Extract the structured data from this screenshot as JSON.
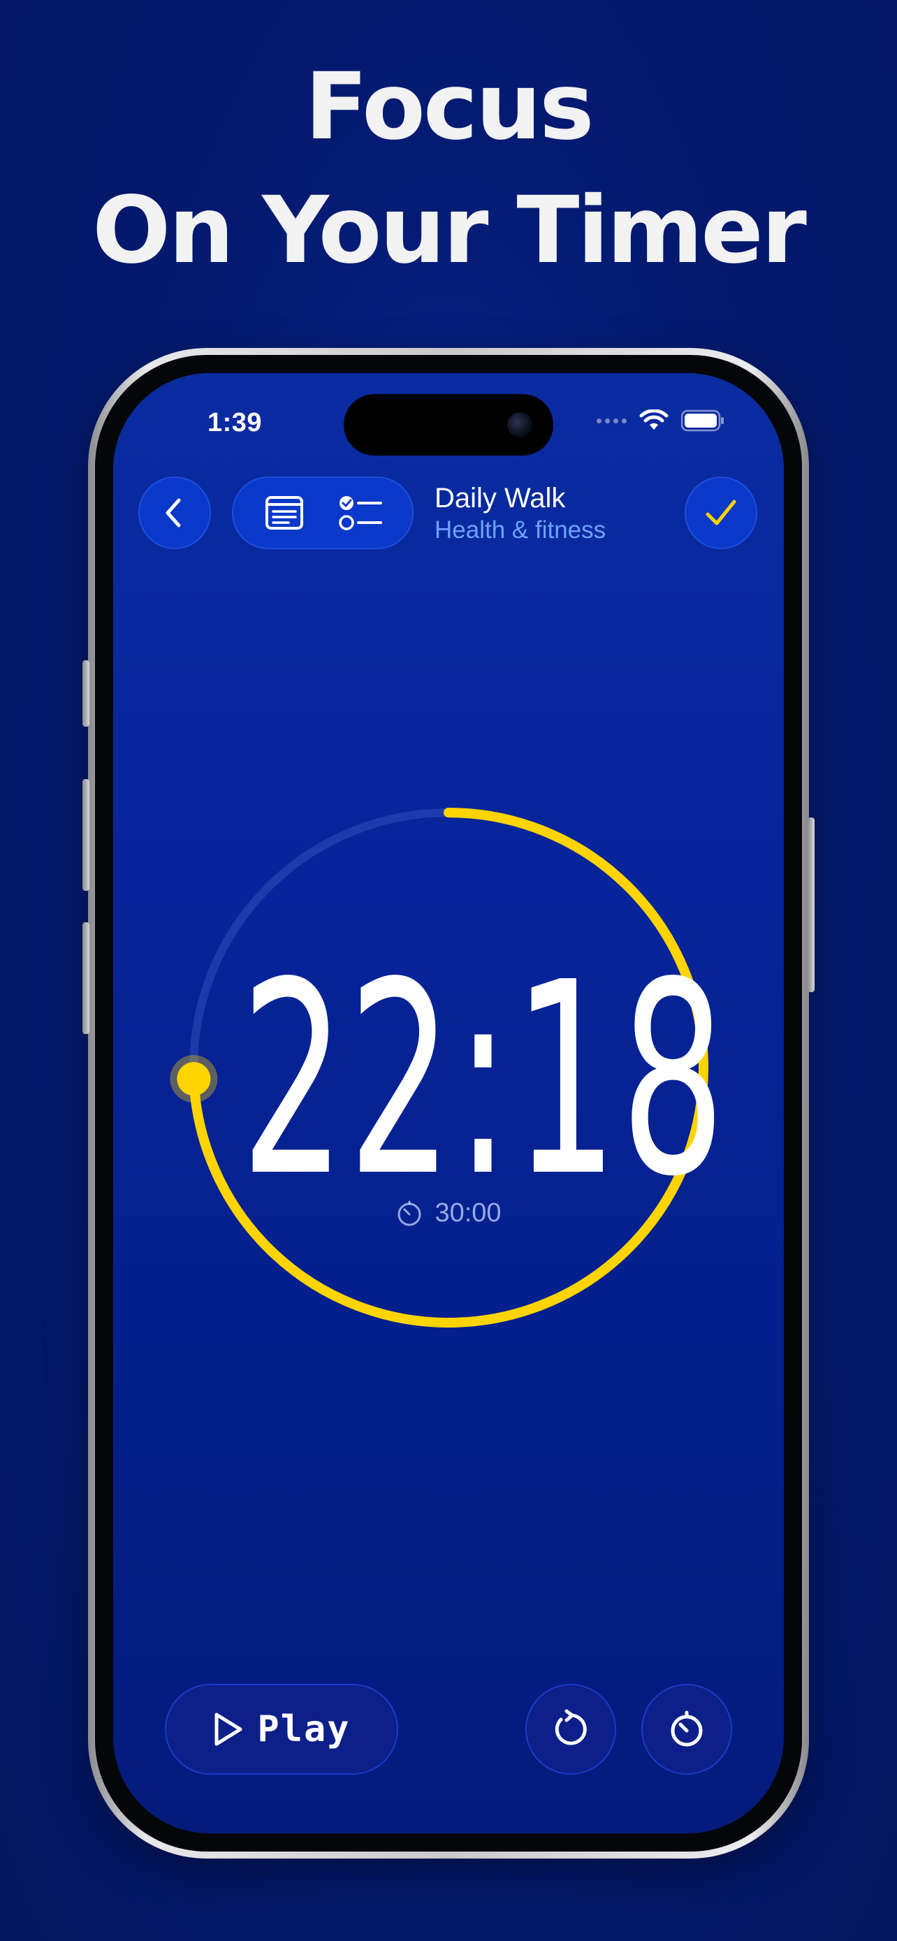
{
  "headline": {
    "line1": "Focus",
    "line2": "On Your Timer"
  },
  "status_bar": {
    "time": "1:39"
  },
  "toolbar": {
    "back_icon": "chevron-left-icon",
    "notes_icon": "notes-icon",
    "checklist_icon": "checklist-icon",
    "title": "Daily Walk",
    "subtitle": "Health & fitness",
    "done_icon": "checkmark-icon"
  },
  "timer": {
    "remaining": "22:18",
    "total": "30:00",
    "progress_remaining_fraction": 0.743
  },
  "controls": {
    "play_label": "Play",
    "reset_icon": "reset-icon",
    "timer_icon": "timer-icon"
  },
  "colors": {
    "background": "#031a70",
    "screen": "#07249a",
    "accent_yellow": "#ffd400",
    "subtitle_blue": "#6ea2ff"
  }
}
